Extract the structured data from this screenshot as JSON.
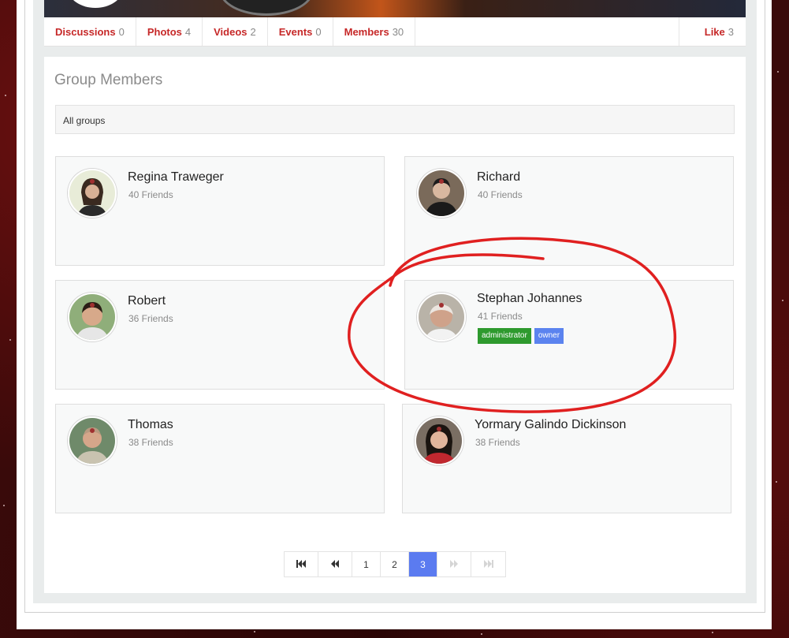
{
  "tabs": [
    {
      "label": "Discussions",
      "count": "0"
    },
    {
      "label": "Photos",
      "count": "4"
    },
    {
      "label": "Videos",
      "count": "2"
    },
    {
      "label": "Events",
      "count": "0"
    },
    {
      "label": "Members",
      "count": "30"
    }
  ],
  "like": {
    "label": "Like",
    "count": "3"
  },
  "panel": {
    "title": "Group Members",
    "filter": "All groups"
  },
  "members": [
    {
      "name": "Regina Traweger",
      "friends": "40 Friends"
    },
    {
      "name": "Richard",
      "friends": "40 Friends"
    },
    {
      "name": "Robert",
      "friends": "36 Friends"
    },
    {
      "name": "Stephan Johannes",
      "friends": "41 Friends",
      "badges": [
        "administrator",
        "owner"
      ]
    },
    {
      "name": "Thomas",
      "friends": "38 Friends"
    },
    {
      "name": "Yormary Galindo Dickinson",
      "friends": "38 Friends"
    }
  ],
  "pagination": {
    "first_icon": "first-page-icon",
    "prev_icon": "previous-page-icon",
    "pages": [
      "1",
      "2",
      "3"
    ],
    "current": "3",
    "next_icon": "next-page-icon",
    "last_icon": "last-page-icon"
  },
  "colors": {
    "tab_label": "#c62828",
    "admin_badge": "#2e9a2e",
    "owner_badge": "#5b83ef",
    "active_page": "#5b7bf0",
    "annotation": "#e02020"
  }
}
